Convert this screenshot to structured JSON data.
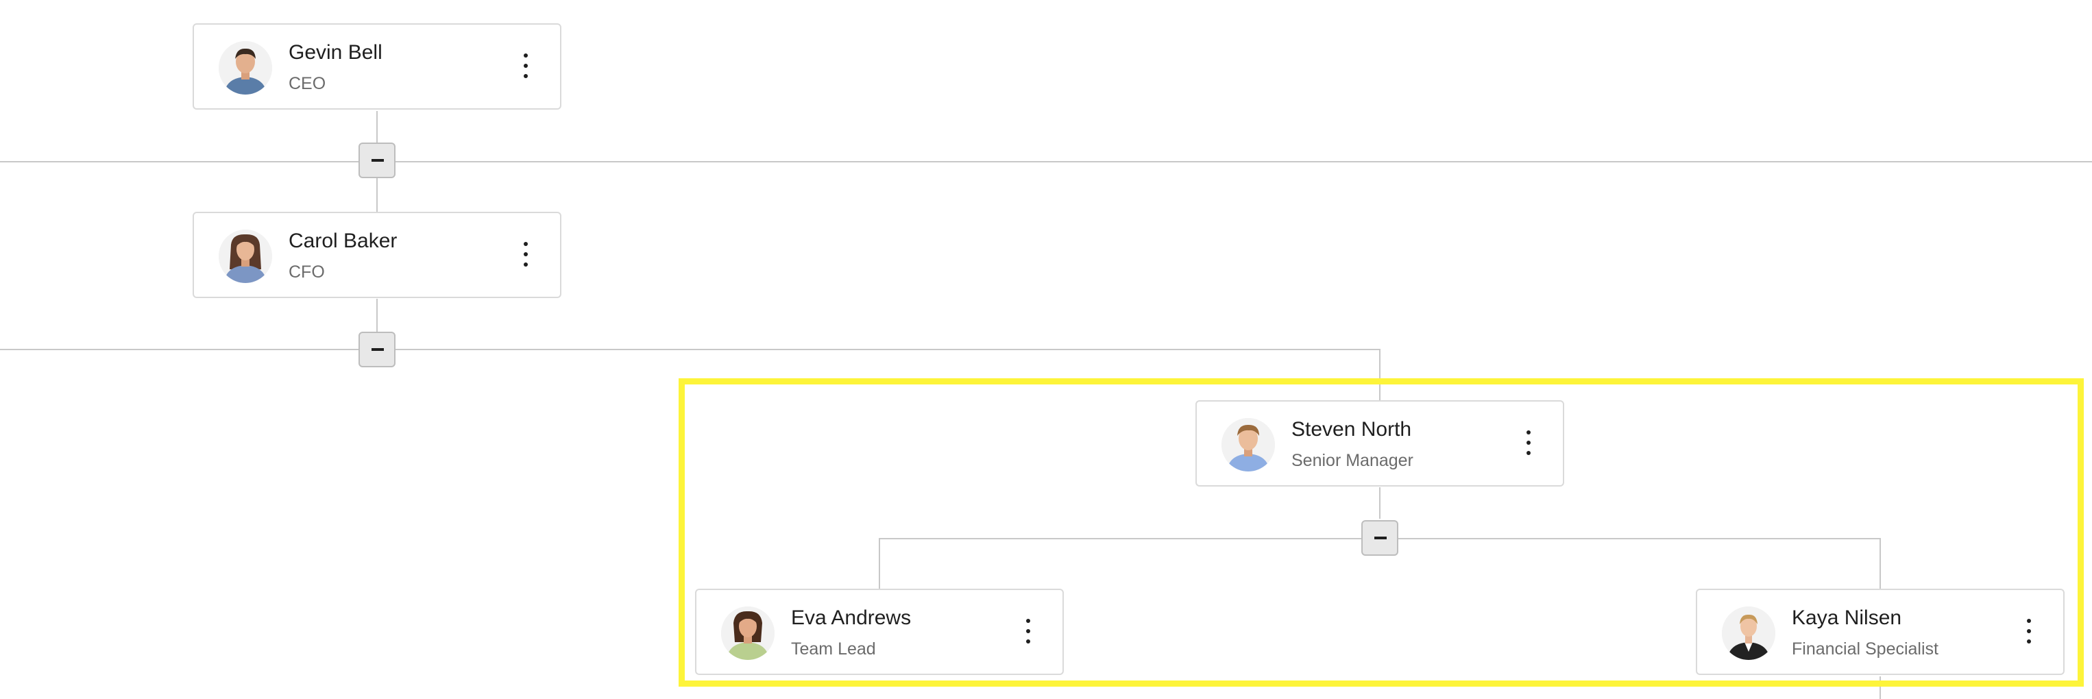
{
  "org_chart": {
    "nodes": [
      {
        "key": "gevin",
        "name": "Gevin Bell",
        "title": "CEO",
        "avatar_icon": "man-portrait-icon",
        "shirt_color": "#5a7da8"
      },
      {
        "key": "carol",
        "name": "Carol Baker",
        "title": "CFO",
        "avatar_icon": "woman-portrait-icon",
        "shirt_color": "#7c96c4"
      },
      {
        "key": "steven",
        "name": "Steven North",
        "title": "Senior Manager",
        "avatar_icon": "man-portrait-icon",
        "shirt_color": "#8eaee3"
      },
      {
        "key": "eva",
        "name": "Eva Andrews",
        "title": "Team Lead",
        "avatar_icon": "woman-portrait-icon",
        "shirt_color": "#b9cf8f"
      },
      {
        "key": "kaya",
        "name": "Kaya Nilsen",
        "title": "Financial Specialist",
        "avatar_icon": "woman-portrait-icon",
        "shirt_color": "#222222"
      }
    ],
    "toggle_icon": "collapse-minus-icon",
    "menu_icon": "more-vertical-icon",
    "colors": {
      "connector": "#c8c8c8",
      "highlight": "#fdf43a",
      "card_border": "#dadada",
      "toggle_bg": "#e8e8e8"
    }
  }
}
